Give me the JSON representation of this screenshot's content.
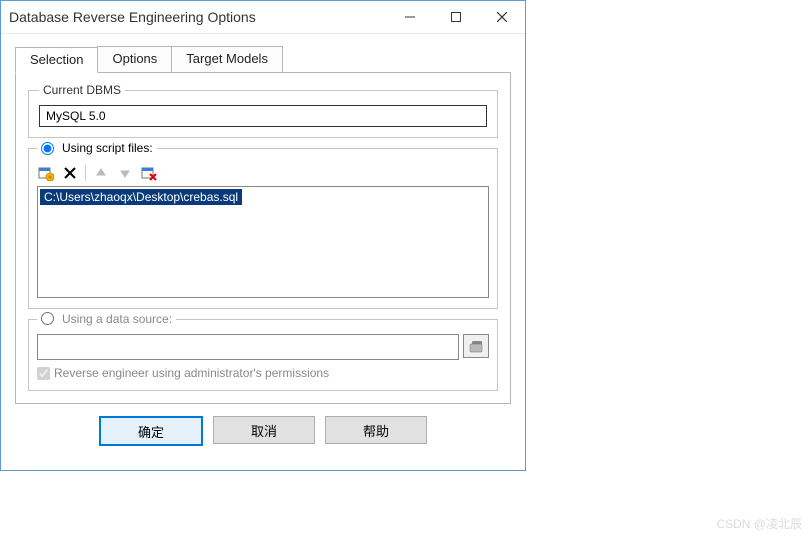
{
  "window": {
    "title": "Database Reverse Engineering Options"
  },
  "tabs": {
    "items": [
      {
        "label": "Selection"
      },
      {
        "label": "Options"
      },
      {
        "label": "Target Models"
      }
    ]
  },
  "dbms": {
    "legend": "Current DBMS",
    "value": "MySQL 5.0"
  },
  "script": {
    "radio_label": "Using script files:",
    "selected_file": "C:\\Users\\zhaoqx\\Desktop\\crebas.sql"
  },
  "datasource": {
    "radio_label": "Using a data source:",
    "value": "",
    "checkbox_label": "Reverse engineer using administrator's permissions"
  },
  "buttons": {
    "ok": "确定",
    "cancel": "取消",
    "help": "帮助"
  },
  "watermark": "CSDN @凌北辰"
}
